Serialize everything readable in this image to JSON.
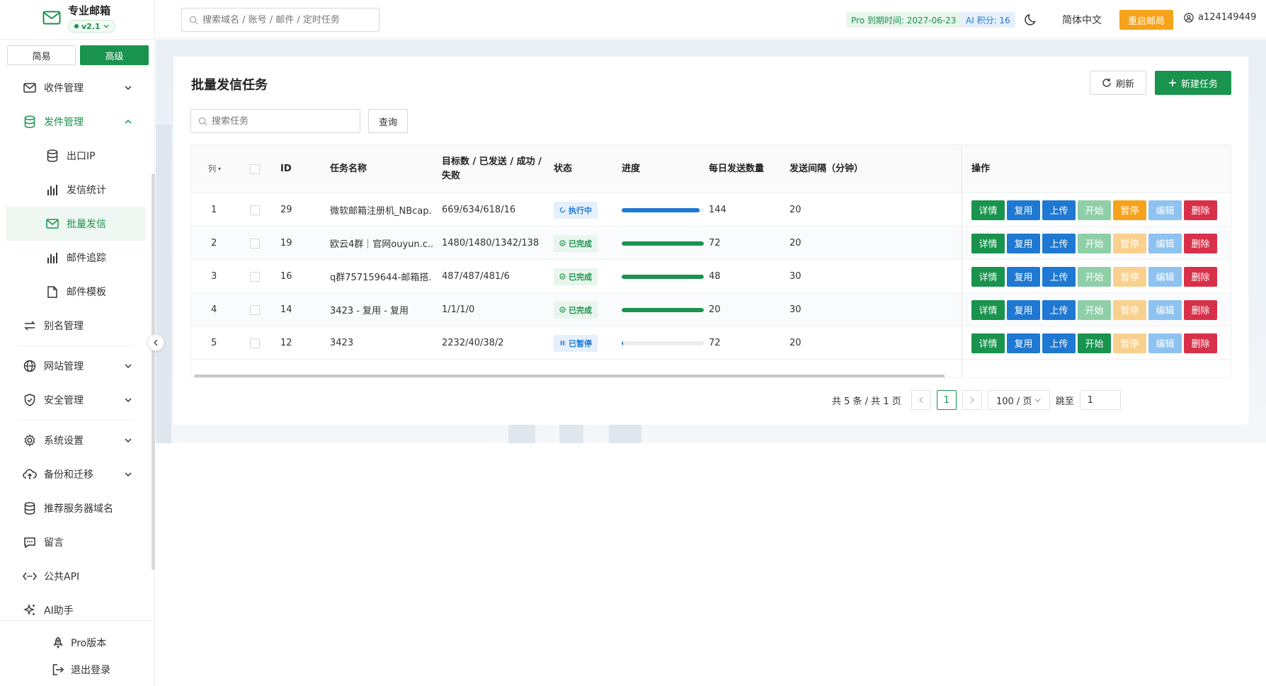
{
  "brand": {
    "name": "专业邮箱",
    "version": "v2.1"
  },
  "mode": {
    "simple": "简易",
    "advanced": "高级"
  },
  "sidebar": {
    "items": [
      {
        "label": "收件管理",
        "icon": "mail-icon"
      },
      {
        "label": "发件管理",
        "icon": "database-icon"
      },
      {
        "label": "出口IP",
        "icon": "database-icon"
      },
      {
        "label": "发信统计",
        "icon": "bar-chart-icon"
      },
      {
        "label": "批量发信",
        "icon": "mail-icon"
      },
      {
        "label": "邮件追踪",
        "icon": "bar-chart-icon"
      },
      {
        "label": "邮件模板",
        "icon": "file-icon"
      },
      {
        "label": "别名管理",
        "icon": "swap-icon"
      },
      {
        "label": "网站管理",
        "icon": "globe-icon"
      },
      {
        "label": "安全管理",
        "icon": "shield-icon"
      },
      {
        "label": "系统设置",
        "icon": "gear-icon"
      },
      {
        "label": "备份和迁移",
        "icon": "cloud-icon"
      },
      {
        "label": "推荐服务器域名",
        "icon": "database-icon"
      },
      {
        "label": "留言",
        "icon": "message-icon"
      },
      {
        "label": "公共API",
        "icon": "api-icon"
      },
      {
        "label": "AI助手",
        "icon": "sparkle-icon"
      }
    ],
    "footer": {
      "pro": "Pro版本",
      "logout": "退出登录"
    }
  },
  "topbar": {
    "search_placeholder": "搜索域名 / 账号 / 邮件 / 定时任务",
    "pro_expiry": "Pro 到期时间: 2027-06-23",
    "ai_points": "AI 积分: 16",
    "language": "简体中文",
    "restart": "重启邮局",
    "username": "a124149449"
  },
  "page": {
    "title": "批量发信任务",
    "refresh": "刷新",
    "new_task": "新建任务",
    "search_placeholder": "搜索任务",
    "query": "查询"
  },
  "table": {
    "headers": {
      "col": "列",
      "id": "ID",
      "name": "任务名称",
      "counts_line1": "目标数 / 已发送 / 成功 /",
      "counts_line2": "失败",
      "status": "状态",
      "progress": "进度",
      "daily": "每日发送数量",
      "interval": "发送间隔（分钟）",
      "ops": "操作"
    },
    "rows": [
      {
        "idx": "1",
        "id": "29",
        "name": "微软邮箱注册机_NBcap...",
        "counts": "669/634/618/16",
        "status": "执行中",
        "status_kind": "running",
        "progress": 0.95,
        "progress_color": "#1f78d1",
        "daily": "144",
        "interval": "20",
        "start_enabled": false,
        "pause_enabled": true
      },
      {
        "idx": "2",
        "id": "19",
        "name": "欧云4群｜官网ouyun.c...",
        "counts": "1480/1480/1342/138",
        "status": "已完成",
        "status_kind": "done",
        "progress": 1.0,
        "progress_color": "#19934d",
        "daily": "72",
        "interval": "20",
        "start_enabled": false,
        "pause_enabled": false
      },
      {
        "idx": "3",
        "id": "16",
        "name": "q群757159644-邮箱搭...",
        "counts": "487/487/481/6",
        "status": "已完成",
        "status_kind": "done",
        "progress": 1.0,
        "progress_color": "#19934d",
        "daily": "48",
        "interval": "30",
        "start_enabled": false,
        "pause_enabled": false
      },
      {
        "idx": "4",
        "id": "14",
        "name": "3423 - 复用 - 复用",
        "counts": "1/1/1/0",
        "status": "已完成",
        "status_kind": "done",
        "progress": 1.0,
        "progress_color": "#19934d",
        "daily": "20",
        "interval": "30",
        "start_enabled": false,
        "pause_enabled": false
      },
      {
        "idx": "5",
        "id": "12",
        "name": "3423",
        "counts": "2232/40/38/2",
        "status": "已暂停",
        "status_kind": "paused",
        "progress": 0.02,
        "progress_color": "#1f78d1",
        "daily": "72",
        "interval": "20",
        "start_enabled": true,
        "pause_enabled": false
      }
    ],
    "ops": {
      "detail": "详情",
      "reuse": "复用",
      "upload": "上传",
      "start": "开始",
      "pause": "暂停",
      "edit": "编辑",
      "delete": "删除"
    }
  },
  "pagination": {
    "total": "共 5 条 / 共 1 页",
    "current_page": "1",
    "page_size": "100 / 页",
    "jump_label": "跳至",
    "jump_value": "1"
  }
}
